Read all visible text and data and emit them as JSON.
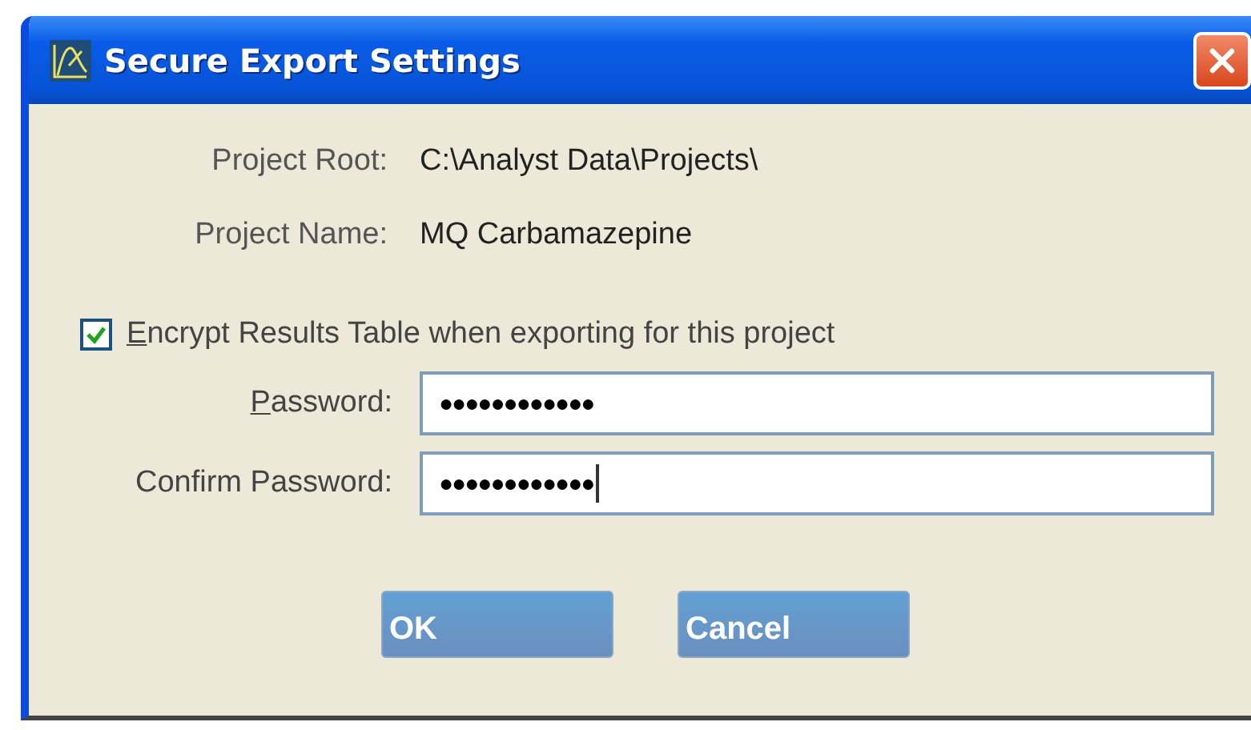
{
  "window": {
    "title": "Secure Export Settings"
  },
  "info": [
    {
      "label": "Project Root:",
      "value": "C:\\Analyst Data\\Projects\\"
    },
    {
      "label": "Project Name:",
      "value": "MQ Carbamazepine"
    }
  ],
  "encrypt": {
    "access_key": "E",
    "label_rest": "ncrypt Results Table when exporting for this project",
    "checked": true
  },
  "fields": [
    {
      "access_key": "P",
      "label_rest": "assword:",
      "value": "●●●●●●●●●●●●",
      "focused": false
    },
    {
      "label_rest": "Confirm Password:",
      "value": "●●●●●●●●●●●●",
      "focused": true
    }
  ],
  "buttons": [
    "OK",
    "Cancel"
  ]
}
